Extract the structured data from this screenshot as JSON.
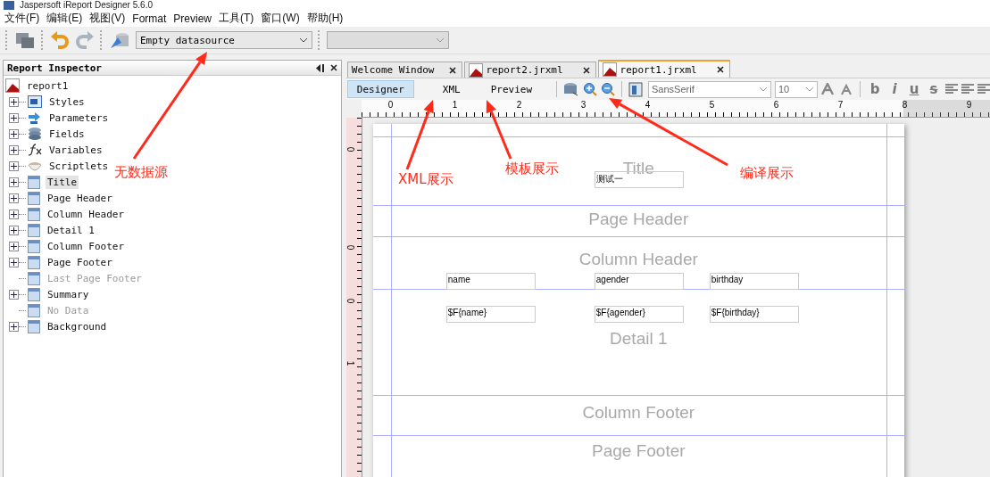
{
  "window": {
    "title": "Jaspersoft iReport Designer 5.6.0"
  },
  "menu": [
    "文件(F)",
    "编辑(E)",
    "视图(V)",
    "Format",
    "Preview",
    "工具(T)",
    "窗口(W)",
    "帮助(H)"
  ],
  "toolbar": {
    "datasource": "Empty datasource"
  },
  "inspector": {
    "title": "Report Inspector",
    "root": "report1",
    "items": [
      {
        "label": "Styles",
        "kind": "styles",
        "disabled": false,
        "selected": false
      },
      {
        "label": "Parameters",
        "kind": "parameters",
        "disabled": false,
        "selected": false
      },
      {
        "label": "Fields",
        "kind": "fields",
        "disabled": false,
        "selected": false
      },
      {
        "label": "Variables",
        "kind": "variables",
        "disabled": false,
        "selected": false
      },
      {
        "label": "Scriptlets",
        "kind": "scriptlets",
        "disabled": false,
        "selected": false
      },
      {
        "label": "Title",
        "kind": "band",
        "disabled": false,
        "selected": true
      },
      {
        "label": "Page Header",
        "kind": "band",
        "disabled": false,
        "selected": false
      },
      {
        "label": "Column Header",
        "kind": "band",
        "disabled": false,
        "selected": false
      },
      {
        "label": "Detail 1",
        "kind": "band",
        "disabled": false,
        "selected": false
      },
      {
        "label": "Column Footer",
        "kind": "band",
        "disabled": false,
        "selected": false
      },
      {
        "label": "Page Footer",
        "kind": "band",
        "disabled": false,
        "selected": false
      },
      {
        "label": "Last Page Footer",
        "kind": "band",
        "disabled": true,
        "selected": false
      },
      {
        "label": "Summary",
        "kind": "band",
        "disabled": false,
        "selected": false
      },
      {
        "label": "No Data",
        "kind": "band",
        "disabled": true,
        "selected": false
      },
      {
        "label": "Background",
        "kind": "band",
        "disabled": false,
        "selected": false
      }
    ]
  },
  "tabs": [
    {
      "label": "Welcome Window",
      "kind": "plain",
      "selected": false
    },
    {
      "label": "report2.jrxml",
      "kind": "report",
      "selected": false
    },
    {
      "label": "report1.jrxml",
      "kind": "report",
      "selected": true
    }
  ],
  "view_tabs": [
    {
      "label": "Designer",
      "selected": true
    },
    {
      "label": "XML",
      "selected": false
    },
    {
      "label": "Preview",
      "selected": false
    }
  ],
  "font": {
    "family": "SansSerif",
    "size": "10"
  },
  "style_buttons": [
    "b",
    "i",
    "u",
    "s"
  ],
  "ruler": [
    "0",
    "1",
    "2",
    "3",
    "4",
    "5",
    "6",
    "7",
    "8",
    "9"
  ],
  "vertical_ruler": [
    "0",
    "0",
    "0",
    "1"
  ],
  "report": {
    "bands": [
      {
        "name": "Title",
        "fields": [
          {
            "text": "测试一"
          }
        ]
      },
      {
        "name": "Page Header"
      },
      {
        "name": "Column Header",
        "fields": [
          {
            "text": "name"
          },
          {
            "text": "agender"
          },
          {
            "text": "birthday"
          }
        ]
      },
      {
        "name": "Detail 1",
        "fields": [
          {
            "text": "$F{name}"
          },
          {
            "text": "$F{agender}"
          },
          {
            "text": "$F{birthday}"
          }
        ]
      },
      {
        "name": "Column Footer"
      },
      {
        "name": "Page Footer"
      }
    ]
  },
  "annotations": [
    {
      "text": "无数据源"
    },
    {
      "text": "XML展示"
    },
    {
      "text": "模板展示"
    },
    {
      "text": "编译展示"
    }
  ]
}
